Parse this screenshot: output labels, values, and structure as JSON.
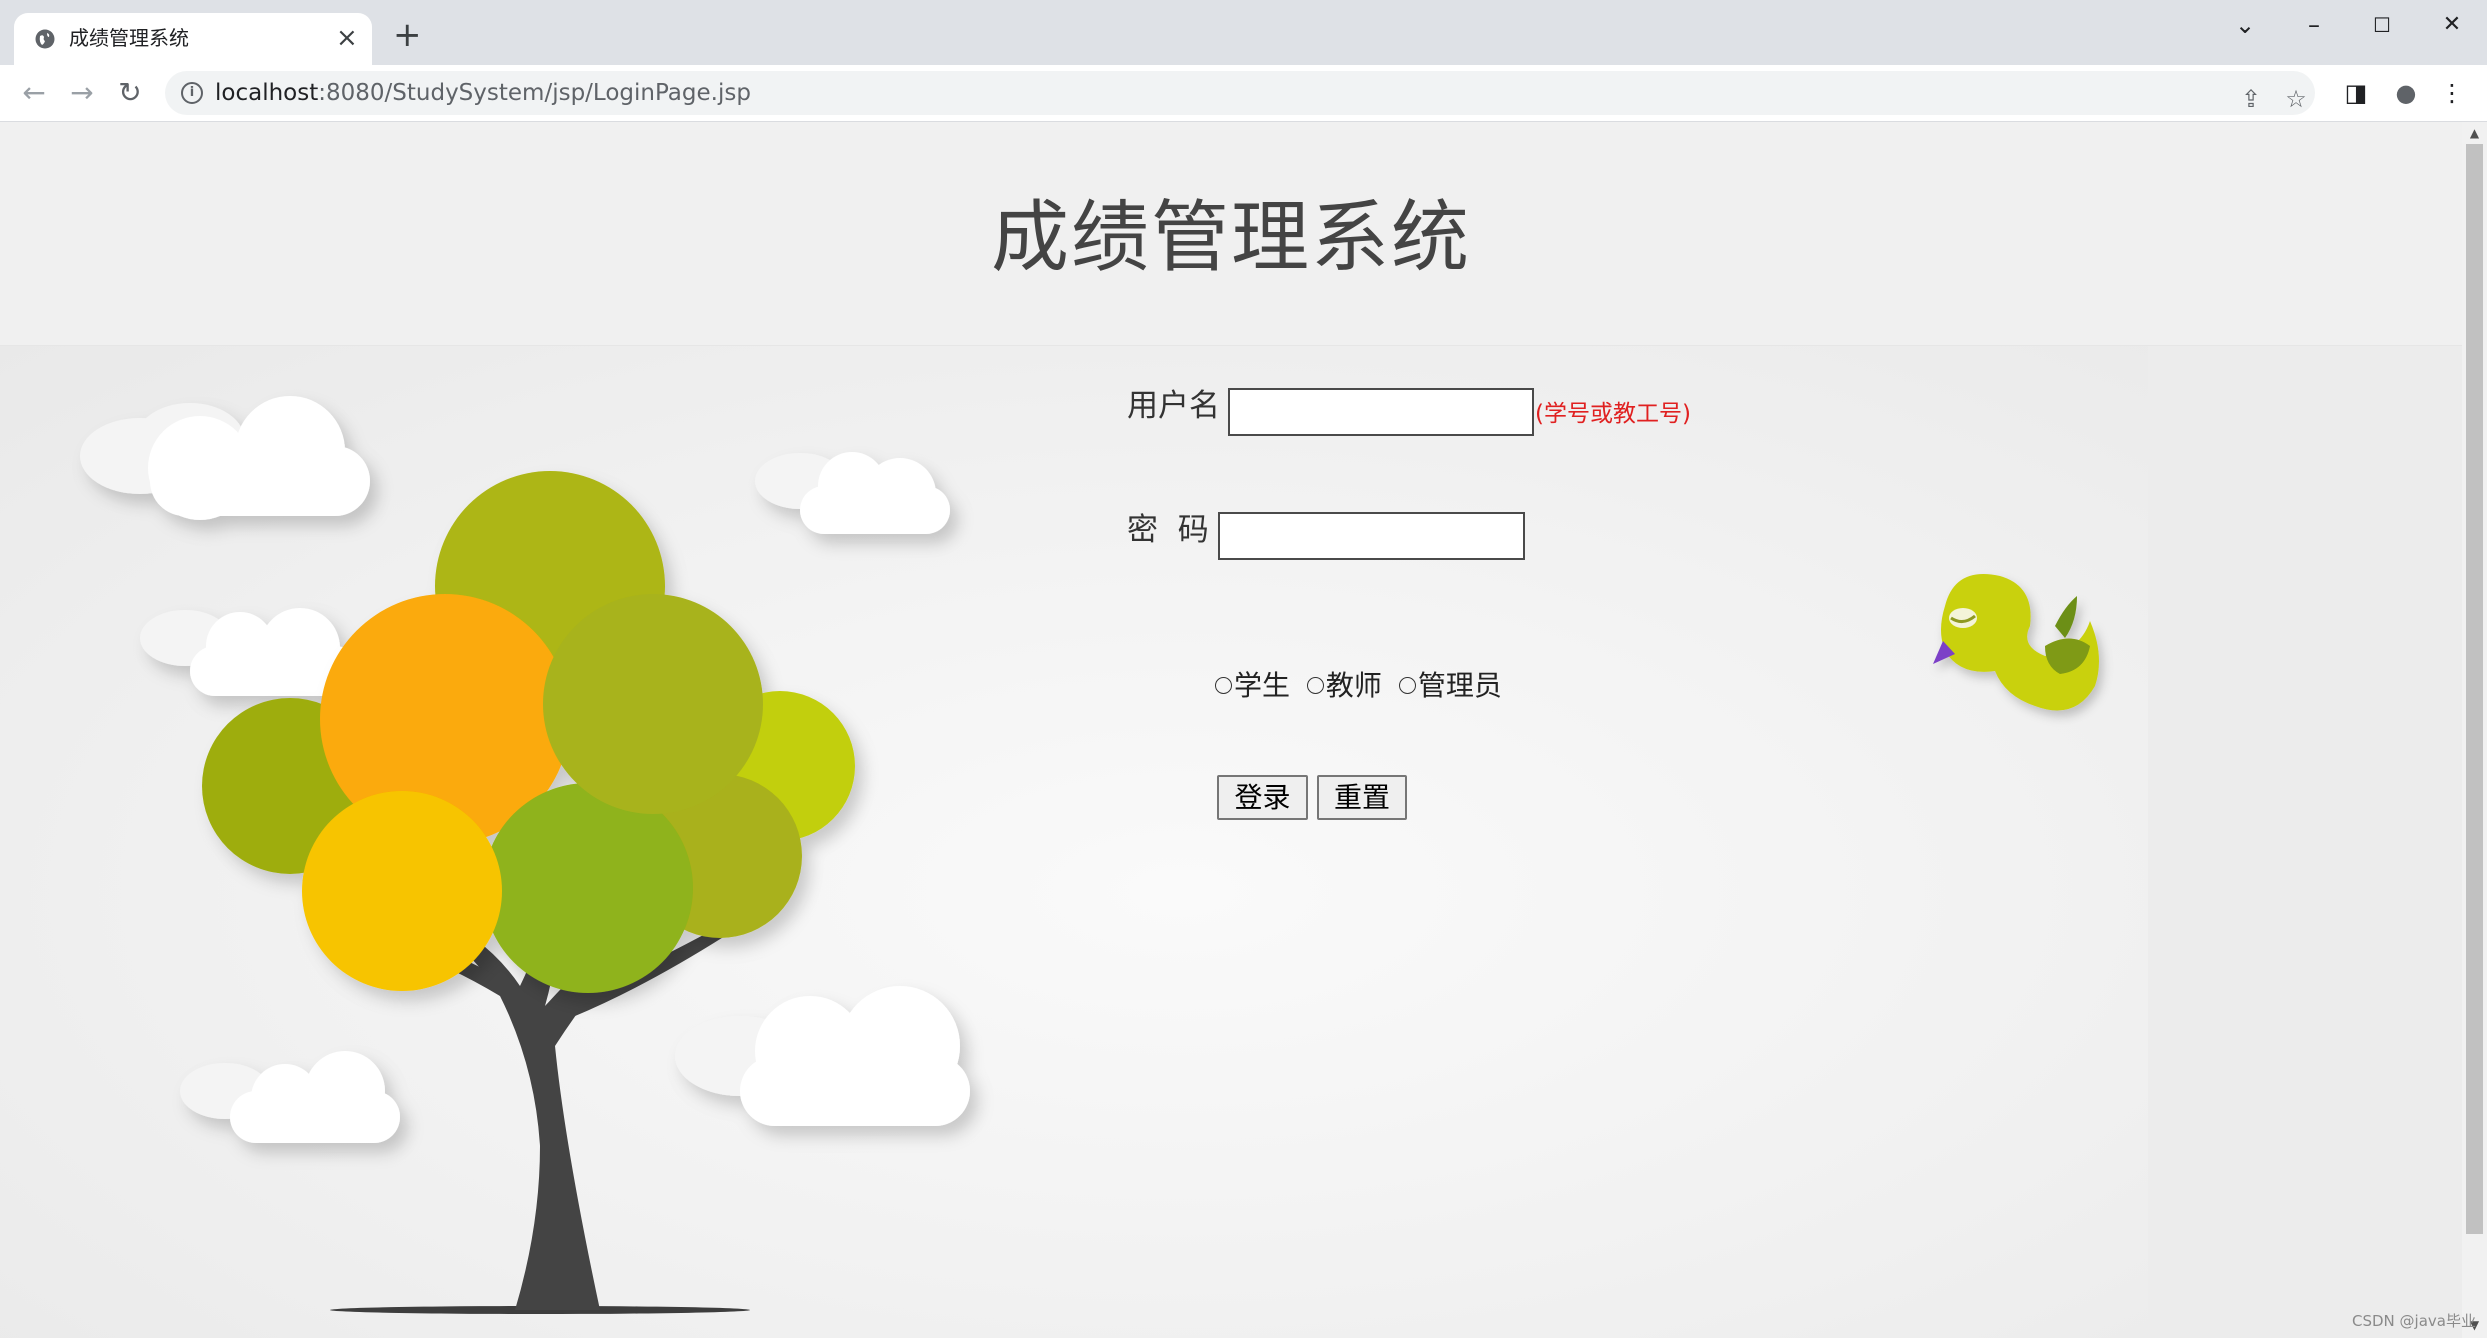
{
  "browser": {
    "tab_title": "成绩管理系统",
    "tab_close": "×",
    "new_tab": "+",
    "url_host": "localhost",
    "url_rest": ":8080/StudySystem/jsp/LoginPage.jsp",
    "window_controls": {
      "tab_search": "⌄",
      "minimize": "–",
      "maximize": "☐",
      "close": "✕"
    },
    "nav": {
      "back": "←",
      "forward": "→",
      "reload": "↻"
    },
    "toolbar_icons": {
      "share": "⇪",
      "bookmark": "☆",
      "side_panel": "◨",
      "profile": "●",
      "menu": "⋮"
    }
  },
  "page": {
    "title": "成绩管理系统"
  },
  "login": {
    "username_label": "用户名",
    "username_value": "",
    "username_hint": "(学号或教工号)",
    "password_label": "密  码",
    "password_value": "",
    "roles": [
      "学生",
      "教师",
      "管理员"
    ],
    "login_button": "登录",
    "reset_button": "重置"
  },
  "watermark": "CSDN @java毕业"
}
